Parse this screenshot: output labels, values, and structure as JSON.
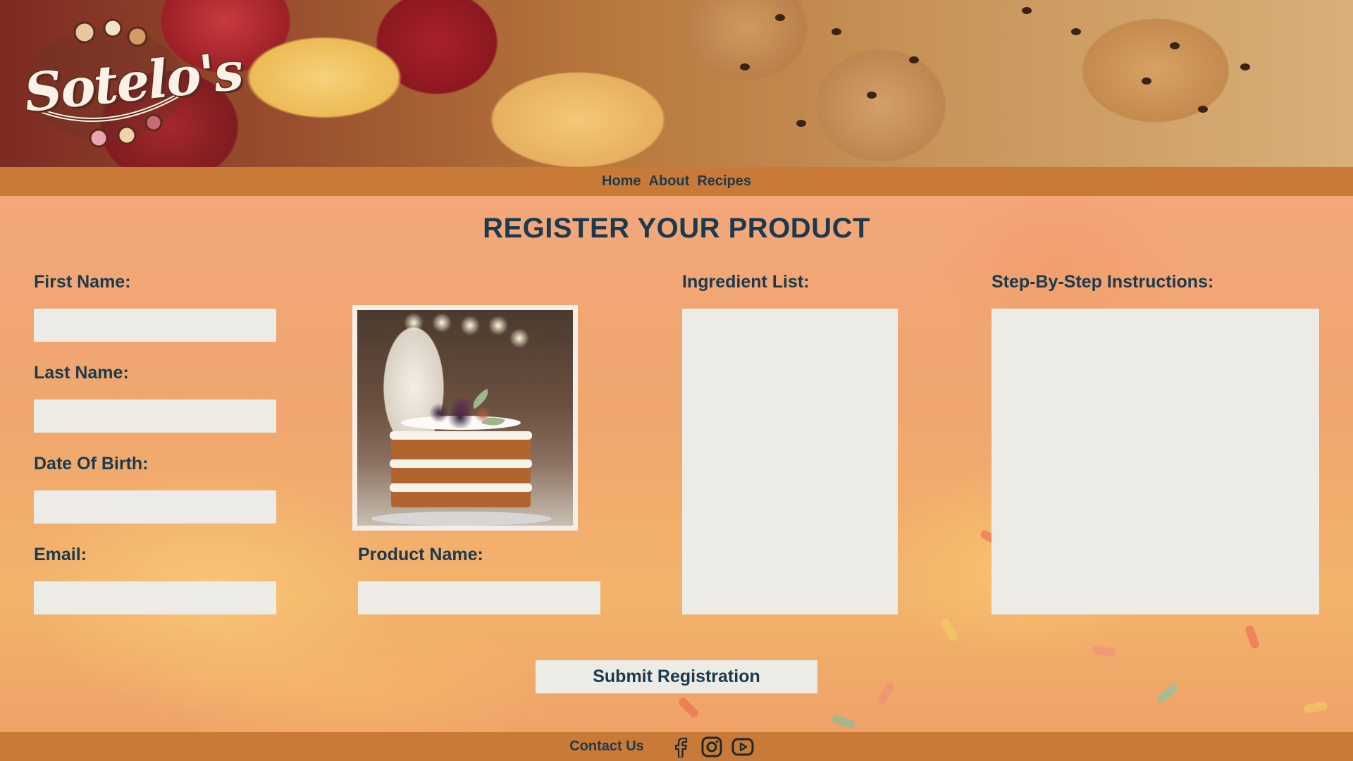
{
  "brand": {
    "logo_text": "Sotelo's"
  },
  "nav": {
    "items": [
      {
        "label": "Home"
      },
      {
        "label": "About"
      },
      {
        "label": "Recipes"
      }
    ]
  },
  "form": {
    "title": "REGISTER YOUR PRODUCT",
    "first_name": {
      "label": "First Name:",
      "value": ""
    },
    "last_name": {
      "label": "Last Name:",
      "value": ""
    },
    "dob": {
      "label": "Date Of Birth:",
      "value": ""
    },
    "email": {
      "label": "Email:",
      "value": ""
    },
    "product_name": {
      "label": "Product Name:",
      "value": ""
    },
    "ingredients": {
      "label": "Ingredient List:",
      "value": ""
    },
    "instructions": {
      "label": "Step-By-Step Instructions:",
      "value": ""
    },
    "submit_label": "Submit Registration"
  },
  "footer": {
    "contact_label": "Contact Us",
    "social": [
      {
        "icon": "facebook-icon"
      },
      {
        "icon": "instagram-icon"
      },
      {
        "icon": "youtube-icon"
      }
    ]
  },
  "colors": {
    "bar": "#c87a36",
    "text": "#1b3a4e",
    "field": "#edebe5"
  }
}
